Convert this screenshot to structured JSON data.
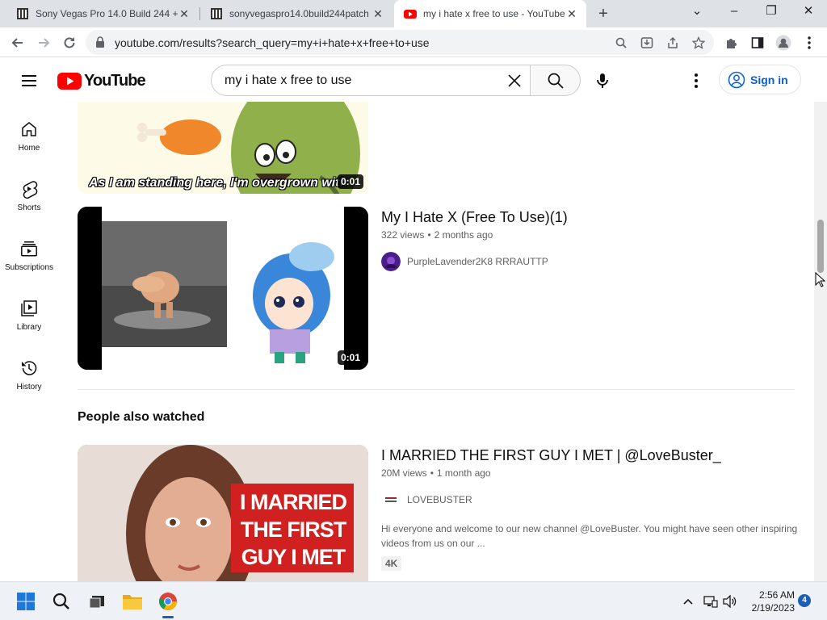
{
  "browser": {
    "tabs": [
      {
        "title": "Sony Vegas Pro 14.0 Build 244 +",
        "close": "✕"
      },
      {
        "title": "sonyvegaspro14.0build244patch",
        "close": "✕"
      },
      {
        "title": "my i hate x free to use - YouTube",
        "close": "✕"
      }
    ],
    "new_tab": "+",
    "window_controls": {
      "dropdown": "⌄",
      "minimize": "–",
      "maximize": "❐",
      "close": "✕"
    },
    "url": "youtube.com/results?search_query=my+i+hate+x+free+to+use"
  },
  "youtube": {
    "logo_text": "YouTube",
    "search_query": "my i hate x free to use",
    "sign_in": "Sign in",
    "colors": {
      "brand_red": "#ff0000",
      "link_blue": "#065fd4"
    }
  },
  "guide": [
    {
      "label": "Home",
      "icon": "home-icon"
    },
    {
      "label": "Shorts",
      "icon": "shorts-icon"
    },
    {
      "label": "Subscriptions",
      "icon": "subscriptions-icon"
    },
    {
      "label": "Library",
      "icon": "library-icon"
    },
    {
      "label": "History",
      "icon": "history-icon"
    }
  ],
  "results": [
    {
      "duration": "0:01",
      "caption": "As I am standing here, I'm overgrown with"
    },
    {
      "title": "My I Hate X (Free To Use)(1)",
      "views": "322 views",
      "age": "2 months ago",
      "channel": "PurpleLavender2K8 RRRAUTTP",
      "duration": "0:01"
    }
  ],
  "people_also_watched": {
    "heading": "People also watched",
    "video": {
      "title": "I MARRIED THE FIRST GUY I MET | @LoveBuster_",
      "views": "20M views",
      "age": "1 month ago",
      "channel": "LOVEBUSTER",
      "description": "Hi everyone and welcome to our new channel @LoveBuster. You might have seen other inspiring videos from us on our ...",
      "badge": "4K",
      "thumb_text": [
        "I MARRIED",
        "THE FIRST",
        "GUY I MET"
      ]
    }
  },
  "taskbar": {
    "time": "2:56 AM",
    "date": "2/19/2023",
    "notifications": "4"
  }
}
